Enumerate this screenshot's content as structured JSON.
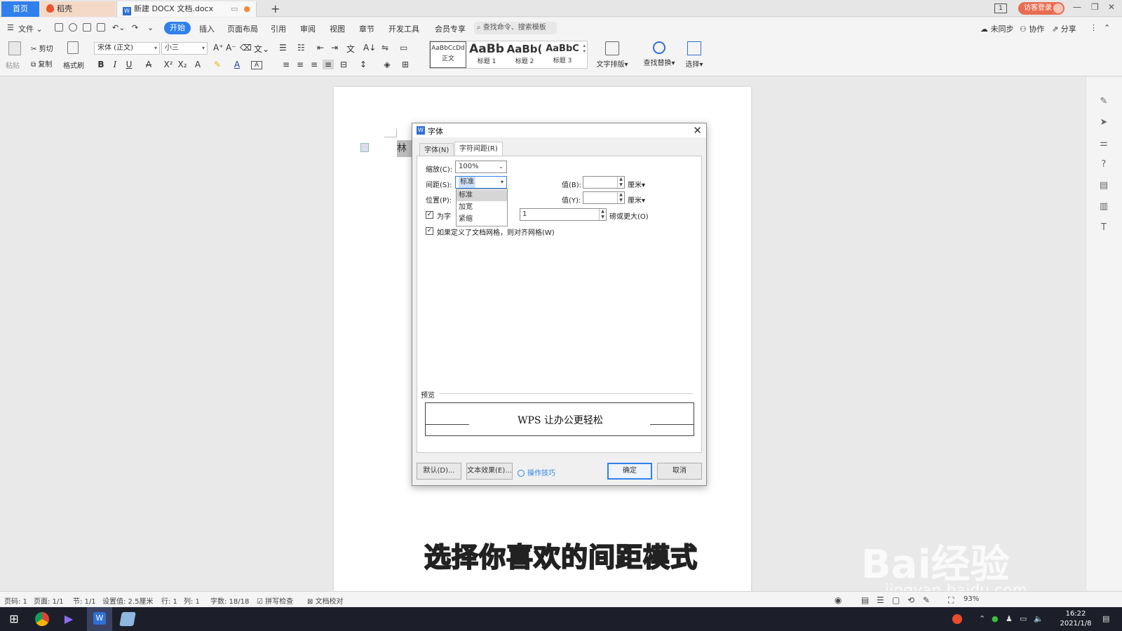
{
  "titlebar": {
    "tabs": {
      "home": "首页",
      "daoke": "稻壳",
      "doc": "新建 DOCX 文档.docx"
    },
    "login": "访客登录",
    "page_num": "1"
  },
  "menu": {
    "file": "文件",
    "items": [
      "开始",
      "插入",
      "页面布局",
      "引用",
      "审阅",
      "视图",
      "章节",
      "开发工具",
      "会员专享"
    ],
    "search": "查找命令、搜索模板",
    "right": {
      "sync": "未同步",
      "collab": "协作",
      "share": "分享"
    }
  },
  "ribbon": {
    "paste": "粘贴",
    "cut": "剪切",
    "copy": "复制",
    "format_painter": "格式刷",
    "font_name": "宋体 (正文)",
    "font_size": "小三",
    "styles": [
      {
        "sample": "AaBbCcDd",
        "name": "正文"
      },
      {
        "sample": "AaBb",
        "name": "标题 1"
      },
      {
        "sample": "AaBb(",
        "name": "标题 2"
      },
      {
        "sample": "AaBbC",
        "name": "标题 3"
      }
    ],
    "text_layout": "文字排版",
    "find_replace": "查找替换",
    "select": "选择"
  },
  "document": {
    "visible_text": "林洁"
  },
  "dialog": {
    "title": "字体",
    "tabs": {
      "font": "字体(N)",
      "spacing": "字符间距(R)"
    },
    "scale_label": "缩放(C):",
    "scale_value": "100%",
    "spacing_label": "间距(S):",
    "spacing_value": "标准",
    "position_label": "位置(P):",
    "value_b_label": "值(B):",
    "value_y_label": "值(Y):",
    "unit_b": "厘米",
    "unit_y": "厘米",
    "kerning_label": "为字体调整字间距(K):",
    "kerning_prefix": "为字",
    "kerning_value": "1",
    "kerning_suffix": "磅或更大(O)",
    "snap_grid_label": "如果定义了文档网格，则对齐网格(W)",
    "dropdown_options": [
      "标准",
      "加宽",
      "紧缩"
    ],
    "preview_label": "预览",
    "preview_text": "WPS 让办公更轻松",
    "buttons": {
      "default": "默认(D)...",
      "text_effect": "文本效果(E)...",
      "tips": "操作技巧",
      "ok": "确定",
      "cancel": "取消"
    }
  },
  "caption": "选择你喜欢的间距模式",
  "watermark": {
    "main": "Bai经验",
    "url": "jingyan.baidu.com"
  },
  "statusbar": {
    "page_code": "页码: 1",
    "pages": "页面: 1/1",
    "section": "节: 1/1",
    "setting": "设置值: 2.5厘米",
    "row": "行: 1",
    "col": "列: 1",
    "word_count": "字数: 18/18",
    "spell_check": "拼写检查",
    "doc_proof": "文档校对",
    "zoom": "93%"
  },
  "taskbar": {
    "time": "16:22",
    "date": "2021/1/8"
  },
  "colors": {
    "accent": "#2f80ed",
    "login": "#e86c52",
    "taskbar": "#1c1f2a"
  }
}
